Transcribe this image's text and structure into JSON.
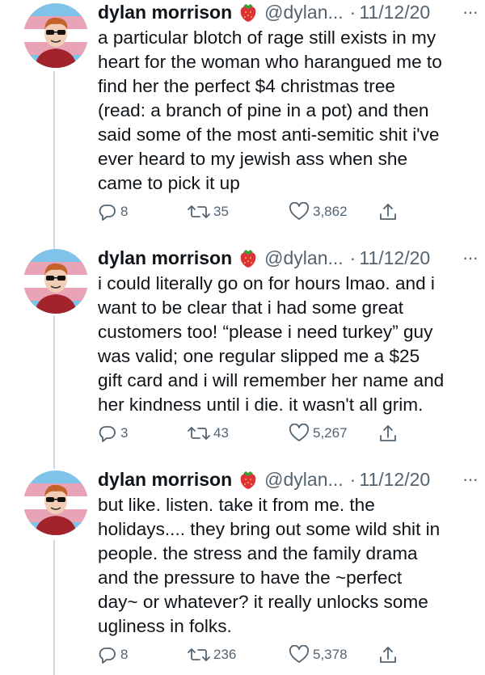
{
  "tweets": [
    {
      "author": "dylan morrison",
      "handle": "@dylan...",
      "dot": "·",
      "date": "11/12/20",
      "more": "···",
      "text": "a particular blotch of rage still exists in my\nheart for the woman who harangued me to\nfind her the perfect $4 christmas tree\n(read: a branch of pine in a pot) and then\nsaid some of the most anti-semitic shit i've\never heard to my jewish ass when she\ncame to pick it up",
      "replies": "8",
      "retweets": "35",
      "likes": "3,862"
    },
    {
      "author": "dylan morrison",
      "handle": "@dylan...",
      "dot": "·",
      "date": "11/12/20",
      "more": "···",
      "text": "i could literally go on for hours lmao. and i\nwant to be clear that i had some great\ncustomers too! “please i need turkey” guy\nwas valid; one regular slipped me a $25\ngift card and i will remember her name and\nher kindness until i die. it wasn't all grim.",
      "replies": "3",
      "retweets": "43",
      "likes": "5,267"
    },
    {
      "author": "dylan morrison",
      "handle": "@dylan...",
      "dot": "·",
      "date": "11/12/20",
      "more": "···",
      "text": "but like. listen. take it from me. the\nholidays.... they bring out some wild shit in\npeople. the stress and the family drama\nand the pressure to have the ~perfect\nday~ or whatever? it really unlocks some\nugliness in folks.",
      "replies": "8",
      "retweets": "236",
      "likes": "5,378"
    }
  ],
  "icons": {
    "emoji": "strawberry-icon",
    "reply": "reply-icon",
    "retweet": "retweet-icon",
    "like": "heart-icon",
    "share": "share-icon"
  },
  "colors": {
    "text": "#0f1419",
    "secondary": "#536471",
    "thread_line": "#cfd9de",
    "trans_blue": "#7fc3e8",
    "trans_pink": "#e9a3b6",
    "trans_white": "#ffffff"
  }
}
